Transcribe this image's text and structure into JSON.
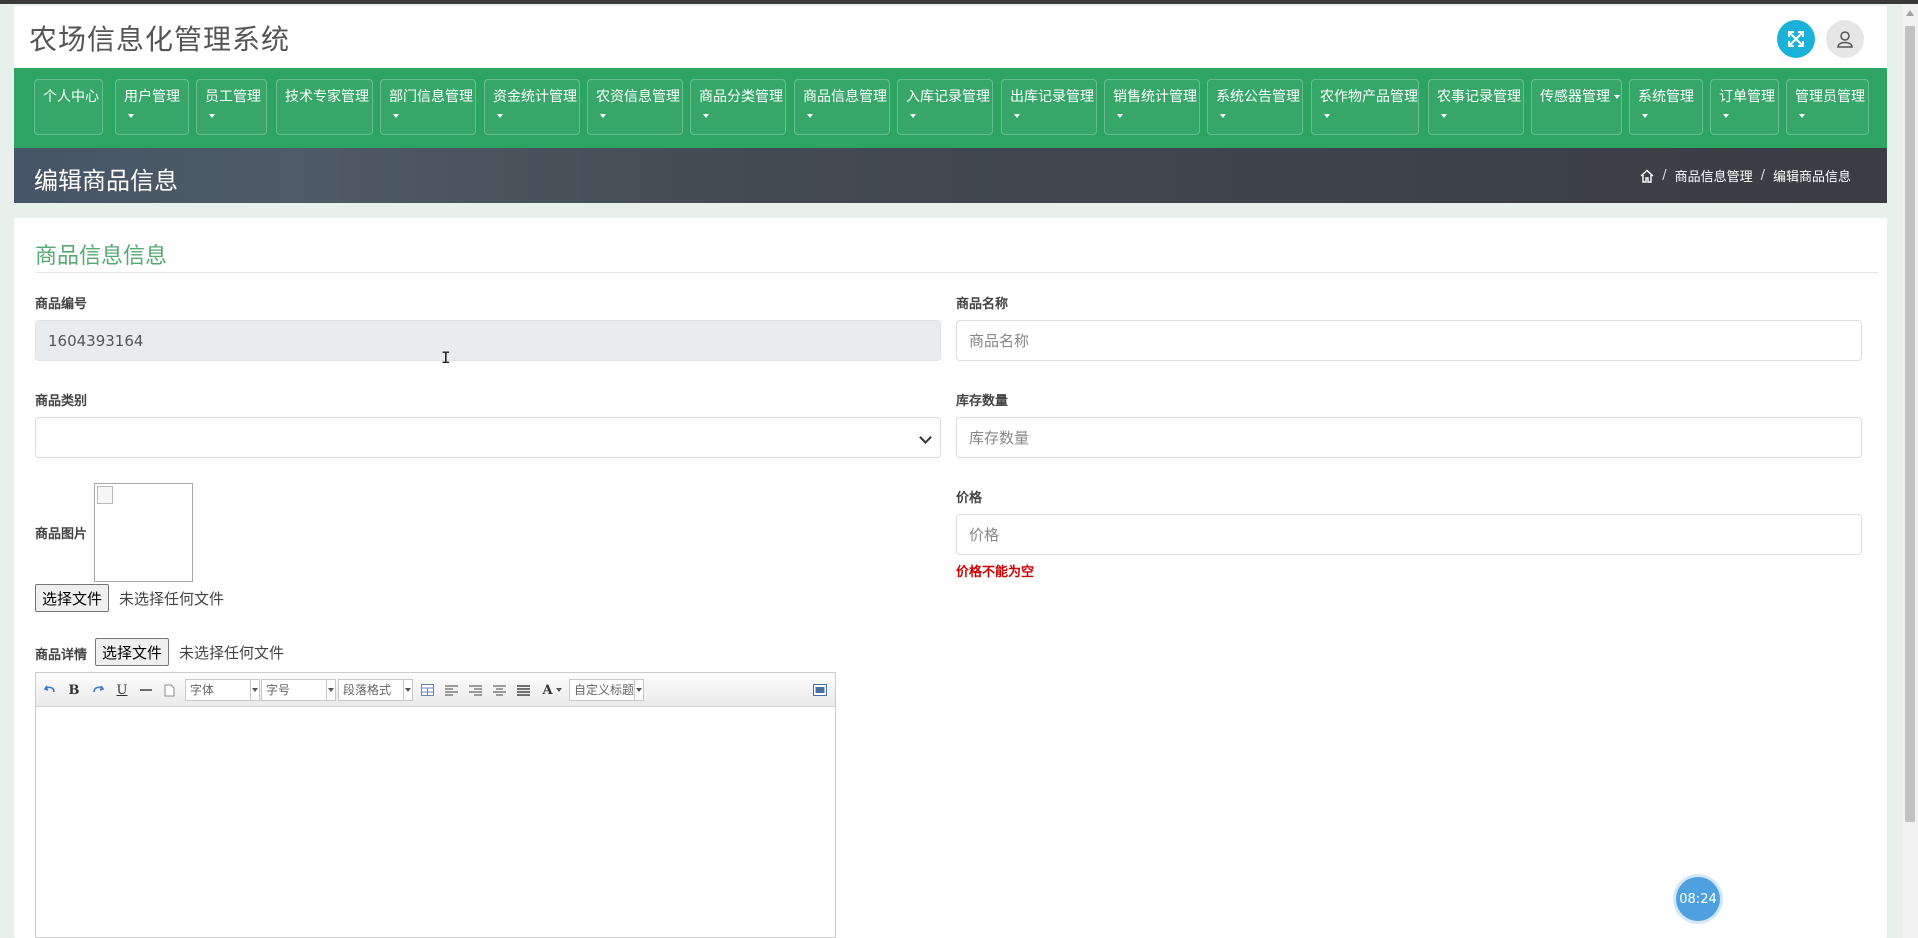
{
  "app": {
    "title": "农场信息化管理系统"
  },
  "header": {
    "fullscreen_icon": "expand-icon",
    "user_icon": "user-icon"
  },
  "nav": {
    "items": [
      {
        "label": "个人中心",
        "caret": false
      },
      {
        "label": "用户管理",
        "caret": true
      },
      {
        "label": "员工管理",
        "caret": true
      },
      {
        "label": "技术专家管理",
        "caret": false
      },
      {
        "label": "部门信息管理",
        "caret": true
      },
      {
        "label": "资金统计管理",
        "caret": true
      },
      {
        "label": "农资信息管理",
        "caret": true
      },
      {
        "label": "商品分类管理",
        "caret": true
      },
      {
        "label": "商品信息管理",
        "caret": true
      },
      {
        "label": "入库记录管理",
        "caret": true
      },
      {
        "label": "出库记录管理",
        "caret": true
      },
      {
        "label": "销售统计管理",
        "caret": true
      },
      {
        "label": "系统公告管理",
        "caret": true
      },
      {
        "label": "农作物产品管理",
        "caret": true
      },
      {
        "label": "农事记录管理",
        "caret": true
      },
      {
        "label": "传感器管理",
        "caret": true
      },
      {
        "label": "系统管理",
        "caret": true
      },
      {
        "label": "订单管理",
        "caret": true
      },
      {
        "label": "管理员管理",
        "caret": true
      }
    ]
  },
  "banner": {
    "page_title": "编辑商品信息",
    "breadcrumb": [
      "商品信息管理",
      "编辑商品信息"
    ]
  },
  "form": {
    "section_title": "商品信息信息",
    "code": {
      "label": "商品编号",
      "value": "1604393164"
    },
    "name": {
      "label": "商品名称",
      "placeholder": "商品名称"
    },
    "category": {
      "label": "商品类别",
      "value": ""
    },
    "stock": {
      "label": "库存数量",
      "placeholder": "库存数量"
    },
    "image": {
      "label": "商品图片",
      "file_button": "选择文件",
      "file_status": "未选择任何文件"
    },
    "price": {
      "label": "价格",
      "placeholder": "价格",
      "error": "价格不能为空"
    },
    "detail": {
      "label": "商品详情",
      "file_button": "选择文件",
      "file_status": "未选择任何文件"
    }
  },
  "editor": {
    "bold": "B",
    "underline": "U",
    "font_family": "字体",
    "font_size": "字号",
    "paragraph": "段落格式",
    "font_color": "A",
    "custom_title": "自定义标题"
  },
  "clock": {
    "time": "08:24"
  },
  "colors": {
    "nav_bg": "#2ea463",
    "accent_green": "#56a874",
    "error": "#cc0000",
    "fullscreen_btn": "#1ab2d8"
  }
}
